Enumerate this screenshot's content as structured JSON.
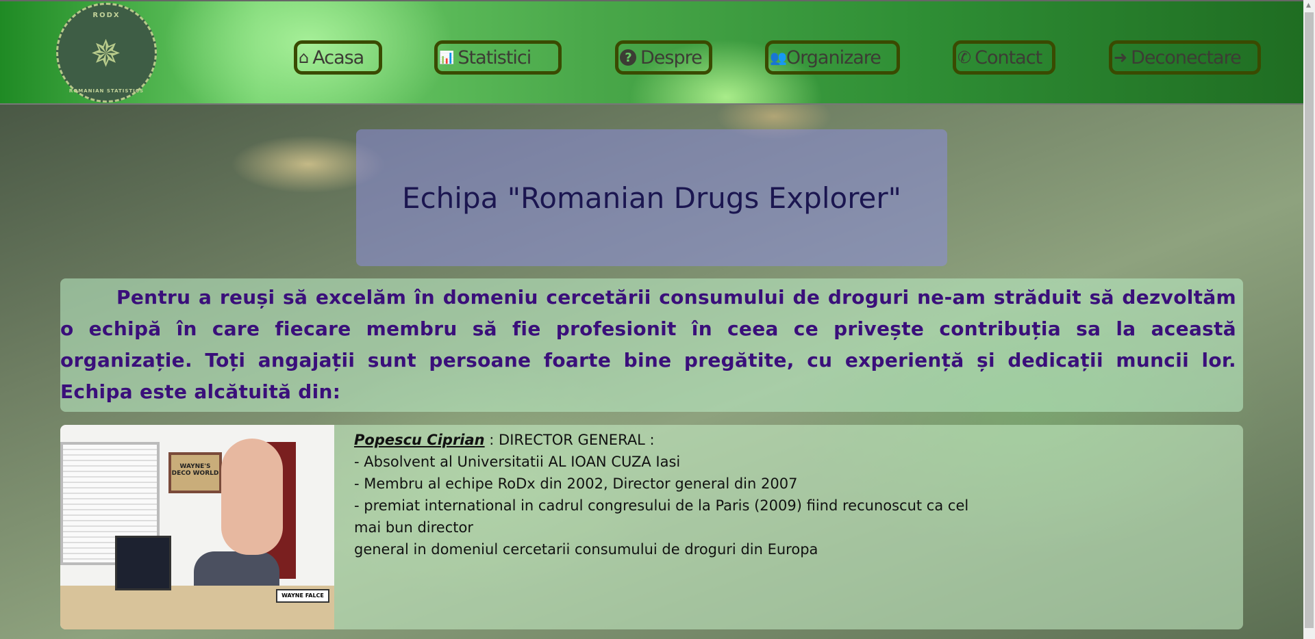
{
  "logo": {
    "top_text": "RODX",
    "bottom_text": "ROMANIAN STATISTICS"
  },
  "nav": [
    {
      "label": "Acasa",
      "icon": "home-icon",
      "glyph": "⌂"
    },
    {
      "label": "Statistici",
      "icon": "bar-chart-icon",
      "glyph": "📊"
    },
    {
      "label": "Despre",
      "icon": "question-circle-icon",
      "glyph": "?"
    },
    {
      "label": "Organizare",
      "icon": "users-icon",
      "glyph": "👥"
    },
    {
      "label": "Contact",
      "icon": "phone-icon",
      "glyph": "✆"
    },
    {
      "label": "Deconectare",
      "icon": "sign-out-icon",
      "glyph": "➜"
    }
  ],
  "title": "Echipa \"Romanian Drugs Explorer\"",
  "intro": "Pentru a reuși să excelăm în domeniu cercetării consumului de droguri ne-am străduit să dezvoltăm o echipă în care fiecare membru să fie profesionit în ceea ce privește contribuția sa la această organizație. Toți angajații sunt persoane foarte bine pregătite, cu experiență și dedicații muncii lor. Echipa este alcătuită din:",
  "members": [
    {
      "name": "Popescu Ciprian",
      "role": " : DIRECTOR GENERAL :",
      "photo": {
        "sign": "WAYNE'S DECO WORLD",
        "nameplate": "WAYNE FALCE"
      },
      "lines": [
        "- Absolvent al Universitatii AL IOAN CUZA Iasi",
        "- Membru al echipe RoDx din 2002, Director general din 2007",
        "- premiat international in cadrul congresului de la Paris (2009) fiind recunoscut ca cel",
        "mai bun director",
        "general in domeniul cercetarii consumului de droguri din Europa"
      ]
    }
  ]
}
